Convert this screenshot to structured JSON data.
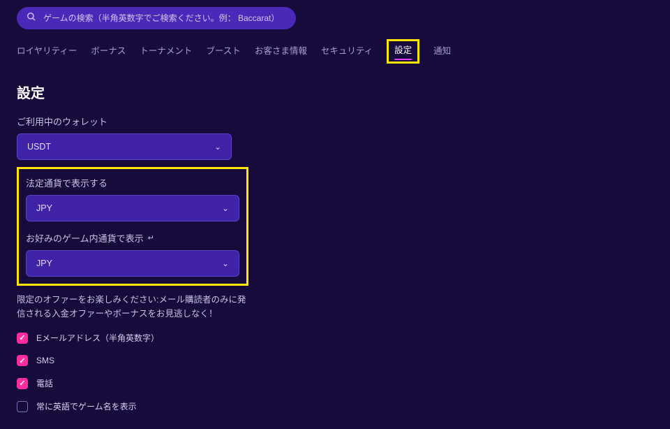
{
  "search": {
    "placeholder": "ゲームの検索（半角英数字でご検索ください。例： Baccarat）"
  },
  "tabs": [
    {
      "label": "ロイヤリティー"
    },
    {
      "label": "ボーナス"
    },
    {
      "label": "トーナメント"
    },
    {
      "label": "ブースト"
    },
    {
      "label": "お客さま情報"
    },
    {
      "label": "セキュリティ"
    },
    {
      "label": "設定",
      "active": true,
      "highlighted": true
    },
    {
      "label": "通知"
    }
  ],
  "settings": {
    "title": "設定",
    "wallet_label": "ご利用中のウォレット",
    "wallet_value": "USDT",
    "fiat_label": "法定通貨で表示する",
    "fiat_value": "JPY",
    "ingame_label": "お好みのゲーム内通貨で表示",
    "ingame_value": "JPY",
    "return_symbol": "↵",
    "offers_desc_line1": "限定のオファーをお楽しみください:メール購読者のみに発",
    "offers_desc_line2": "信される入金オファーやボーナスをお見逃しなく！",
    "checks": [
      {
        "label": "Eメールアドレス（半角英数字）",
        "checked": true
      },
      {
        "label": "SMS",
        "checked": true
      },
      {
        "label": "電話",
        "checked": true
      },
      {
        "label": "常に英語でゲーム名を表示",
        "checked": false
      }
    ]
  }
}
